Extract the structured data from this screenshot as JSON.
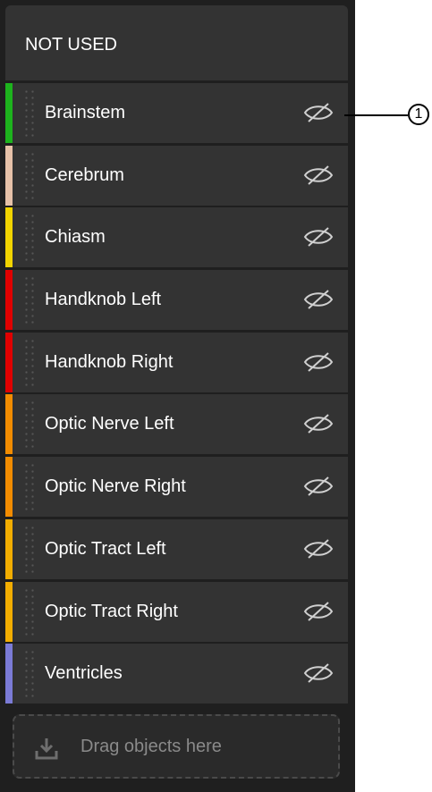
{
  "panel": {
    "title": "NOT USED",
    "items": [
      {
        "label": "Brainstem",
        "color": "#1db31d"
      },
      {
        "label": "Cerebrum",
        "color": "#e6c1a8"
      },
      {
        "label": "Chiasm",
        "color": "#f2d400"
      },
      {
        "label": "Handknob Left",
        "color": "#e00000"
      },
      {
        "label": "Handknob Right",
        "color": "#e00000"
      },
      {
        "label": "Optic Nerve Left",
        "color": "#f28c00"
      },
      {
        "label": "Optic Nerve Right",
        "color": "#f28c00"
      },
      {
        "label": "Optic Tract Left",
        "color": "#f2ad00"
      },
      {
        "label": "Optic Tract Right",
        "color": "#f2ad00"
      },
      {
        "label": "Ventricles",
        "color": "#7b7bd6"
      }
    ],
    "item_icon": "eye-hidden-icon",
    "dropzone": {
      "label": "Drag objects here",
      "icon": "download-tray-icon"
    }
  },
  "callout": {
    "label": "1"
  }
}
